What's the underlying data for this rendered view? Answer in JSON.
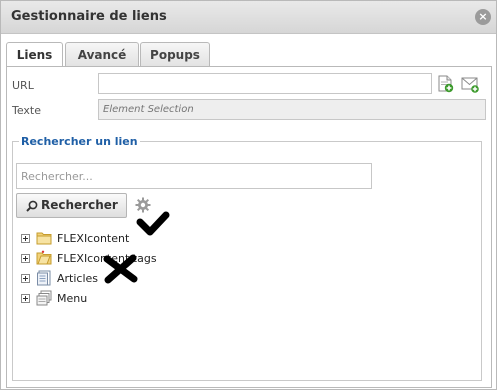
{
  "dialog": {
    "title": "Gestionnaire de liens",
    "close_icon": "close-icon"
  },
  "tabs": [
    {
      "label": "Liens",
      "active": true
    },
    {
      "label": "Avancé",
      "active": false
    },
    {
      "label": "Popups",
      "active": false
    }
  ],
  "form": {
    "url_label": "URL",
    "url_value": "",
    "text_label": "Texte",
    "text_placeholder": "Element Selection"
  },
  "search": {
    "legend": "Rechercher un lien",
    "placeholder": "Rechercher...",
    "button_label": "Rechercher"
  },
  "tree": [
    {
      "label": "FLEXIcontent",
      "icon": "folder-icon"
    },
    {
      "label": "FLEXIcontent tags",
      "icon": "tag-folder-icon"
    },
    {
      "label": "Articles",
      "icon": "article-icon"
    },
    {
      "label": "Menu",
      "icon": "menu-icon"
    }
  ],
  "annotations": [
    {
      "icon": "checkmark-icon"
    },
    {
      "icon": "cross-icon"
    }
  ],
  "colors": {
    "legend": "#1f5fa6",
    "titlebar": "#dedede",
    "border": "#b9b9b9"
  }
}
